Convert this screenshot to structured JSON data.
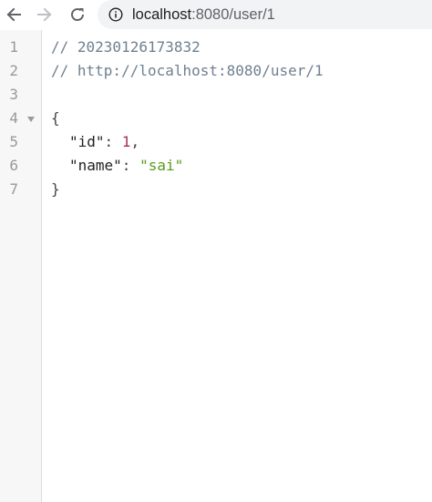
{
  "browser": {
    "url_host": "localhost",
    "url_rest": ":8080/user/1",
    "icons": {
      "back": "arrow-left-icon",
      "forward": "arrow-right-icon",
      "reload": "reload-icon",
      "site_info": "info-icon"
    }
  },
  "viewer": {
    "line_numbers": [
      "1",
      "2",
      "3",
      "4",
      "5",
      "6",
      "7"
    ],
    "comment_timestamp": "// 20230126173832",
    "comment_url": "// http://localhost:8080/user/1",
    "open_brace": "{",
    "close_brace": "}",
    "fields": [
      {
        "key": "\"id\"",
        "colon": ": ",
        "value": "1",
        "comma": ","
      },
      {
        "key": "\"name\"",
        "colon": ": ",
        "value": "\"sai\"",
        "comma": ""
      }
    ],
    "colors": {
      "number": "#a0315f",
      "string": "#5a9a1a",
      "comment": "#708090",
      "line_number": "#999999"
    }
  }
}
